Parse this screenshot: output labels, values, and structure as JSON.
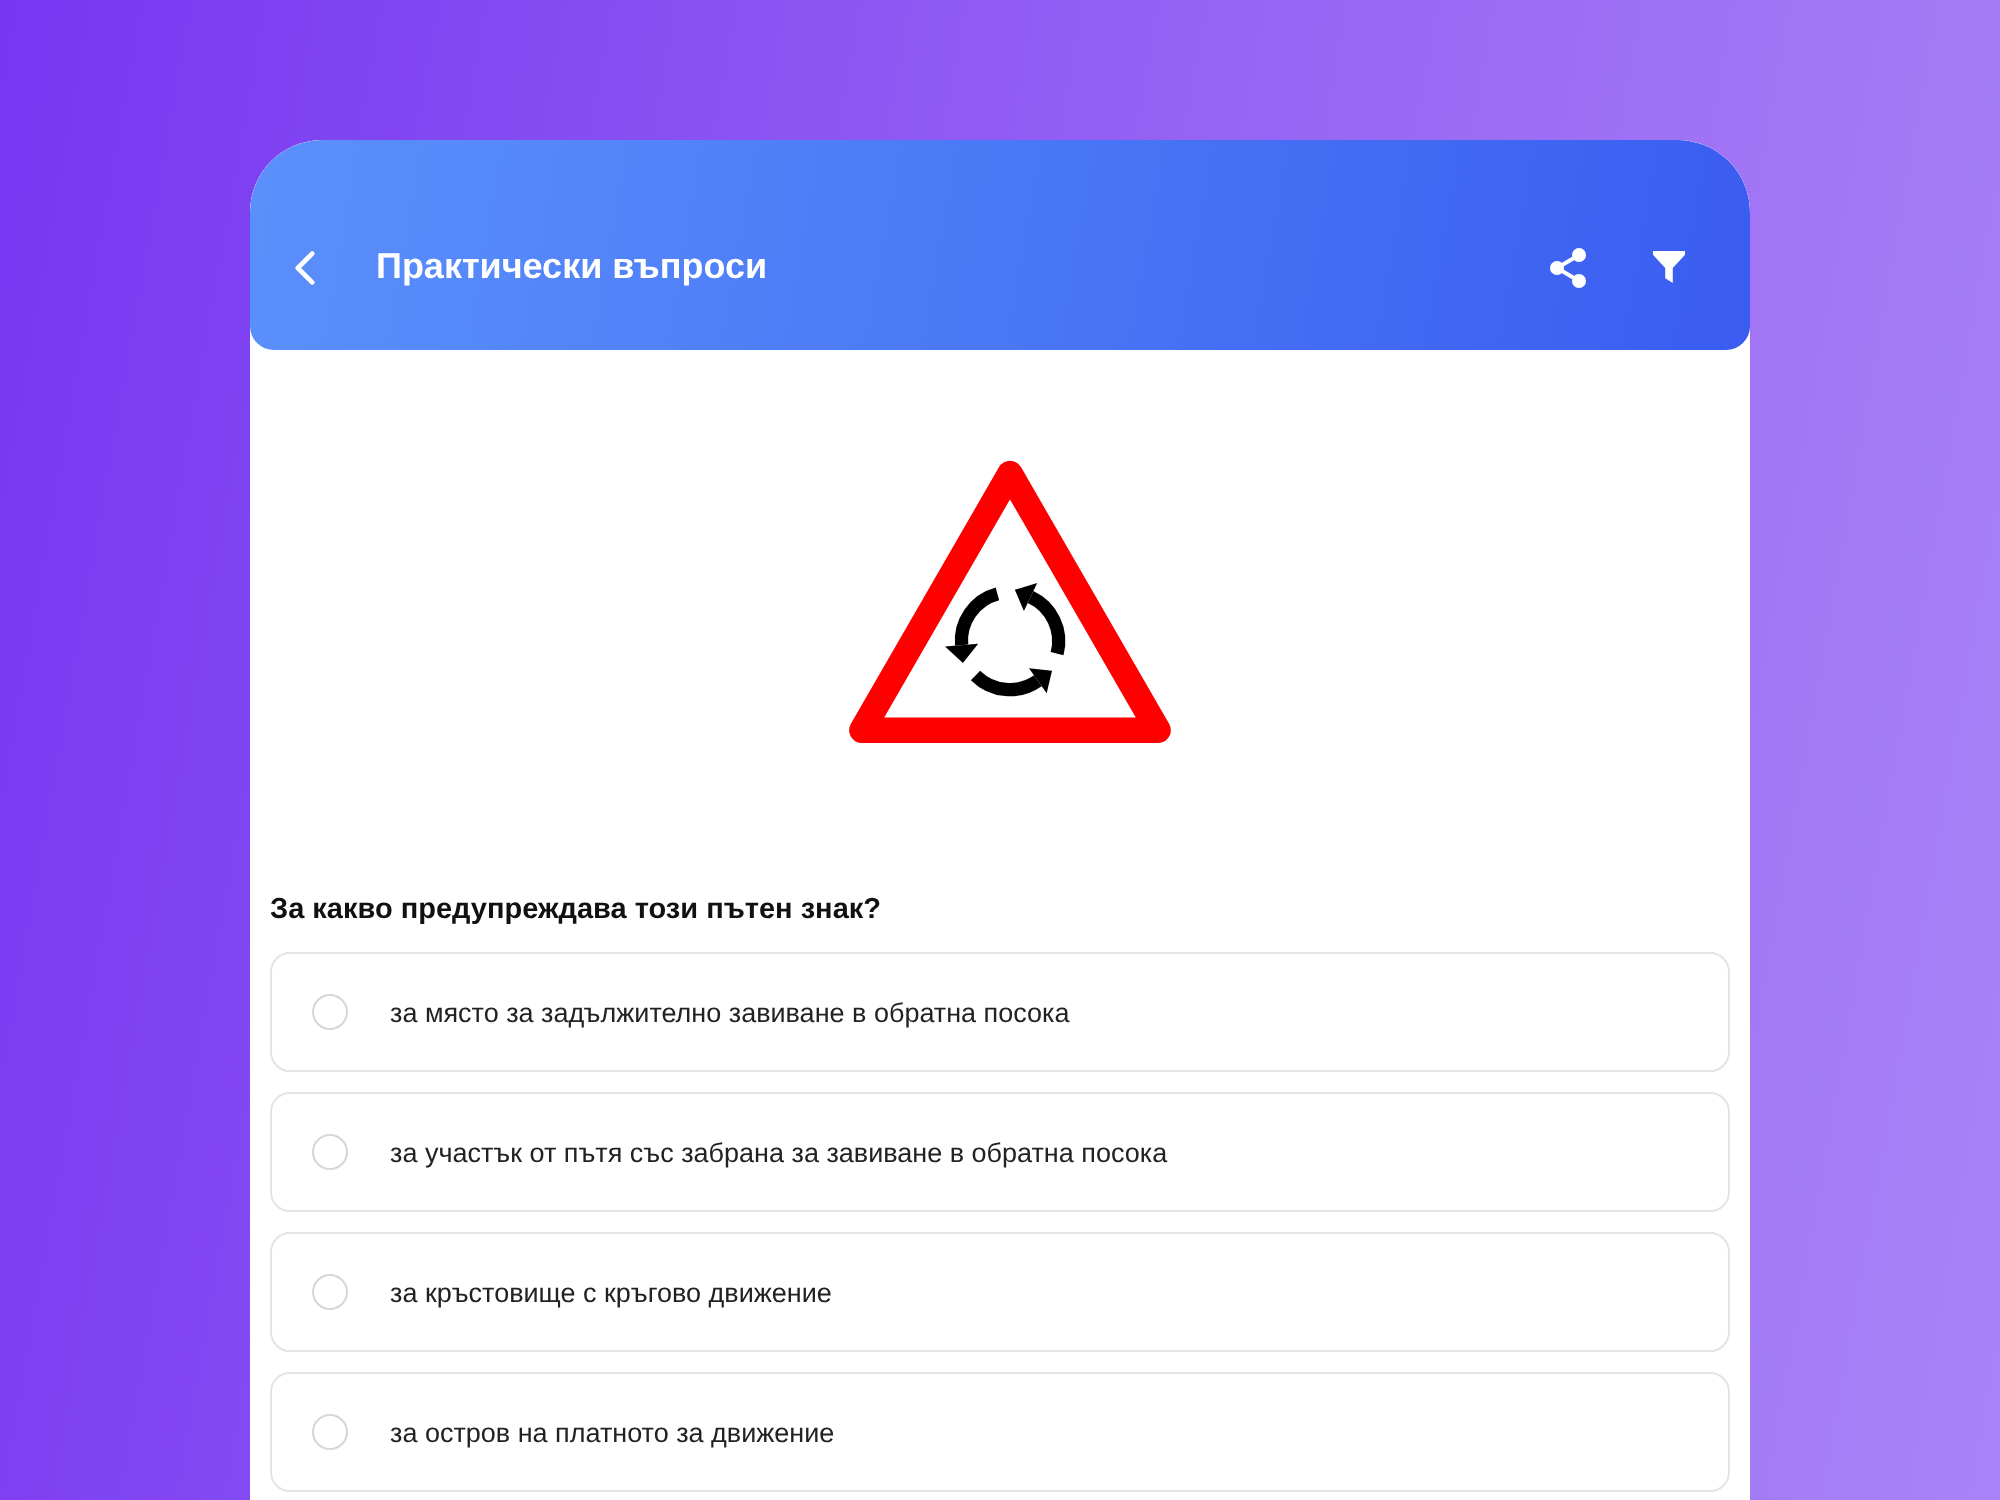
{
  "header": {
    "title": "Практически въпроси"
  },
  "question": "За какво предупреждава този пътен знак?",
  "answers": [
    {
      "text": "за място за задължително завиване в обратна посока",
      "selected": false
    },
    {
      "text": "за участък от пътя със забрана за завиване в обратна посока",
      "selected": false
    },
    {
      "text": "за кръстовище с кръгово движение",
      "selected": false
    },
    {
      "text": "за остров на платното за движение",
      "selected": false
    }
  ]
}
